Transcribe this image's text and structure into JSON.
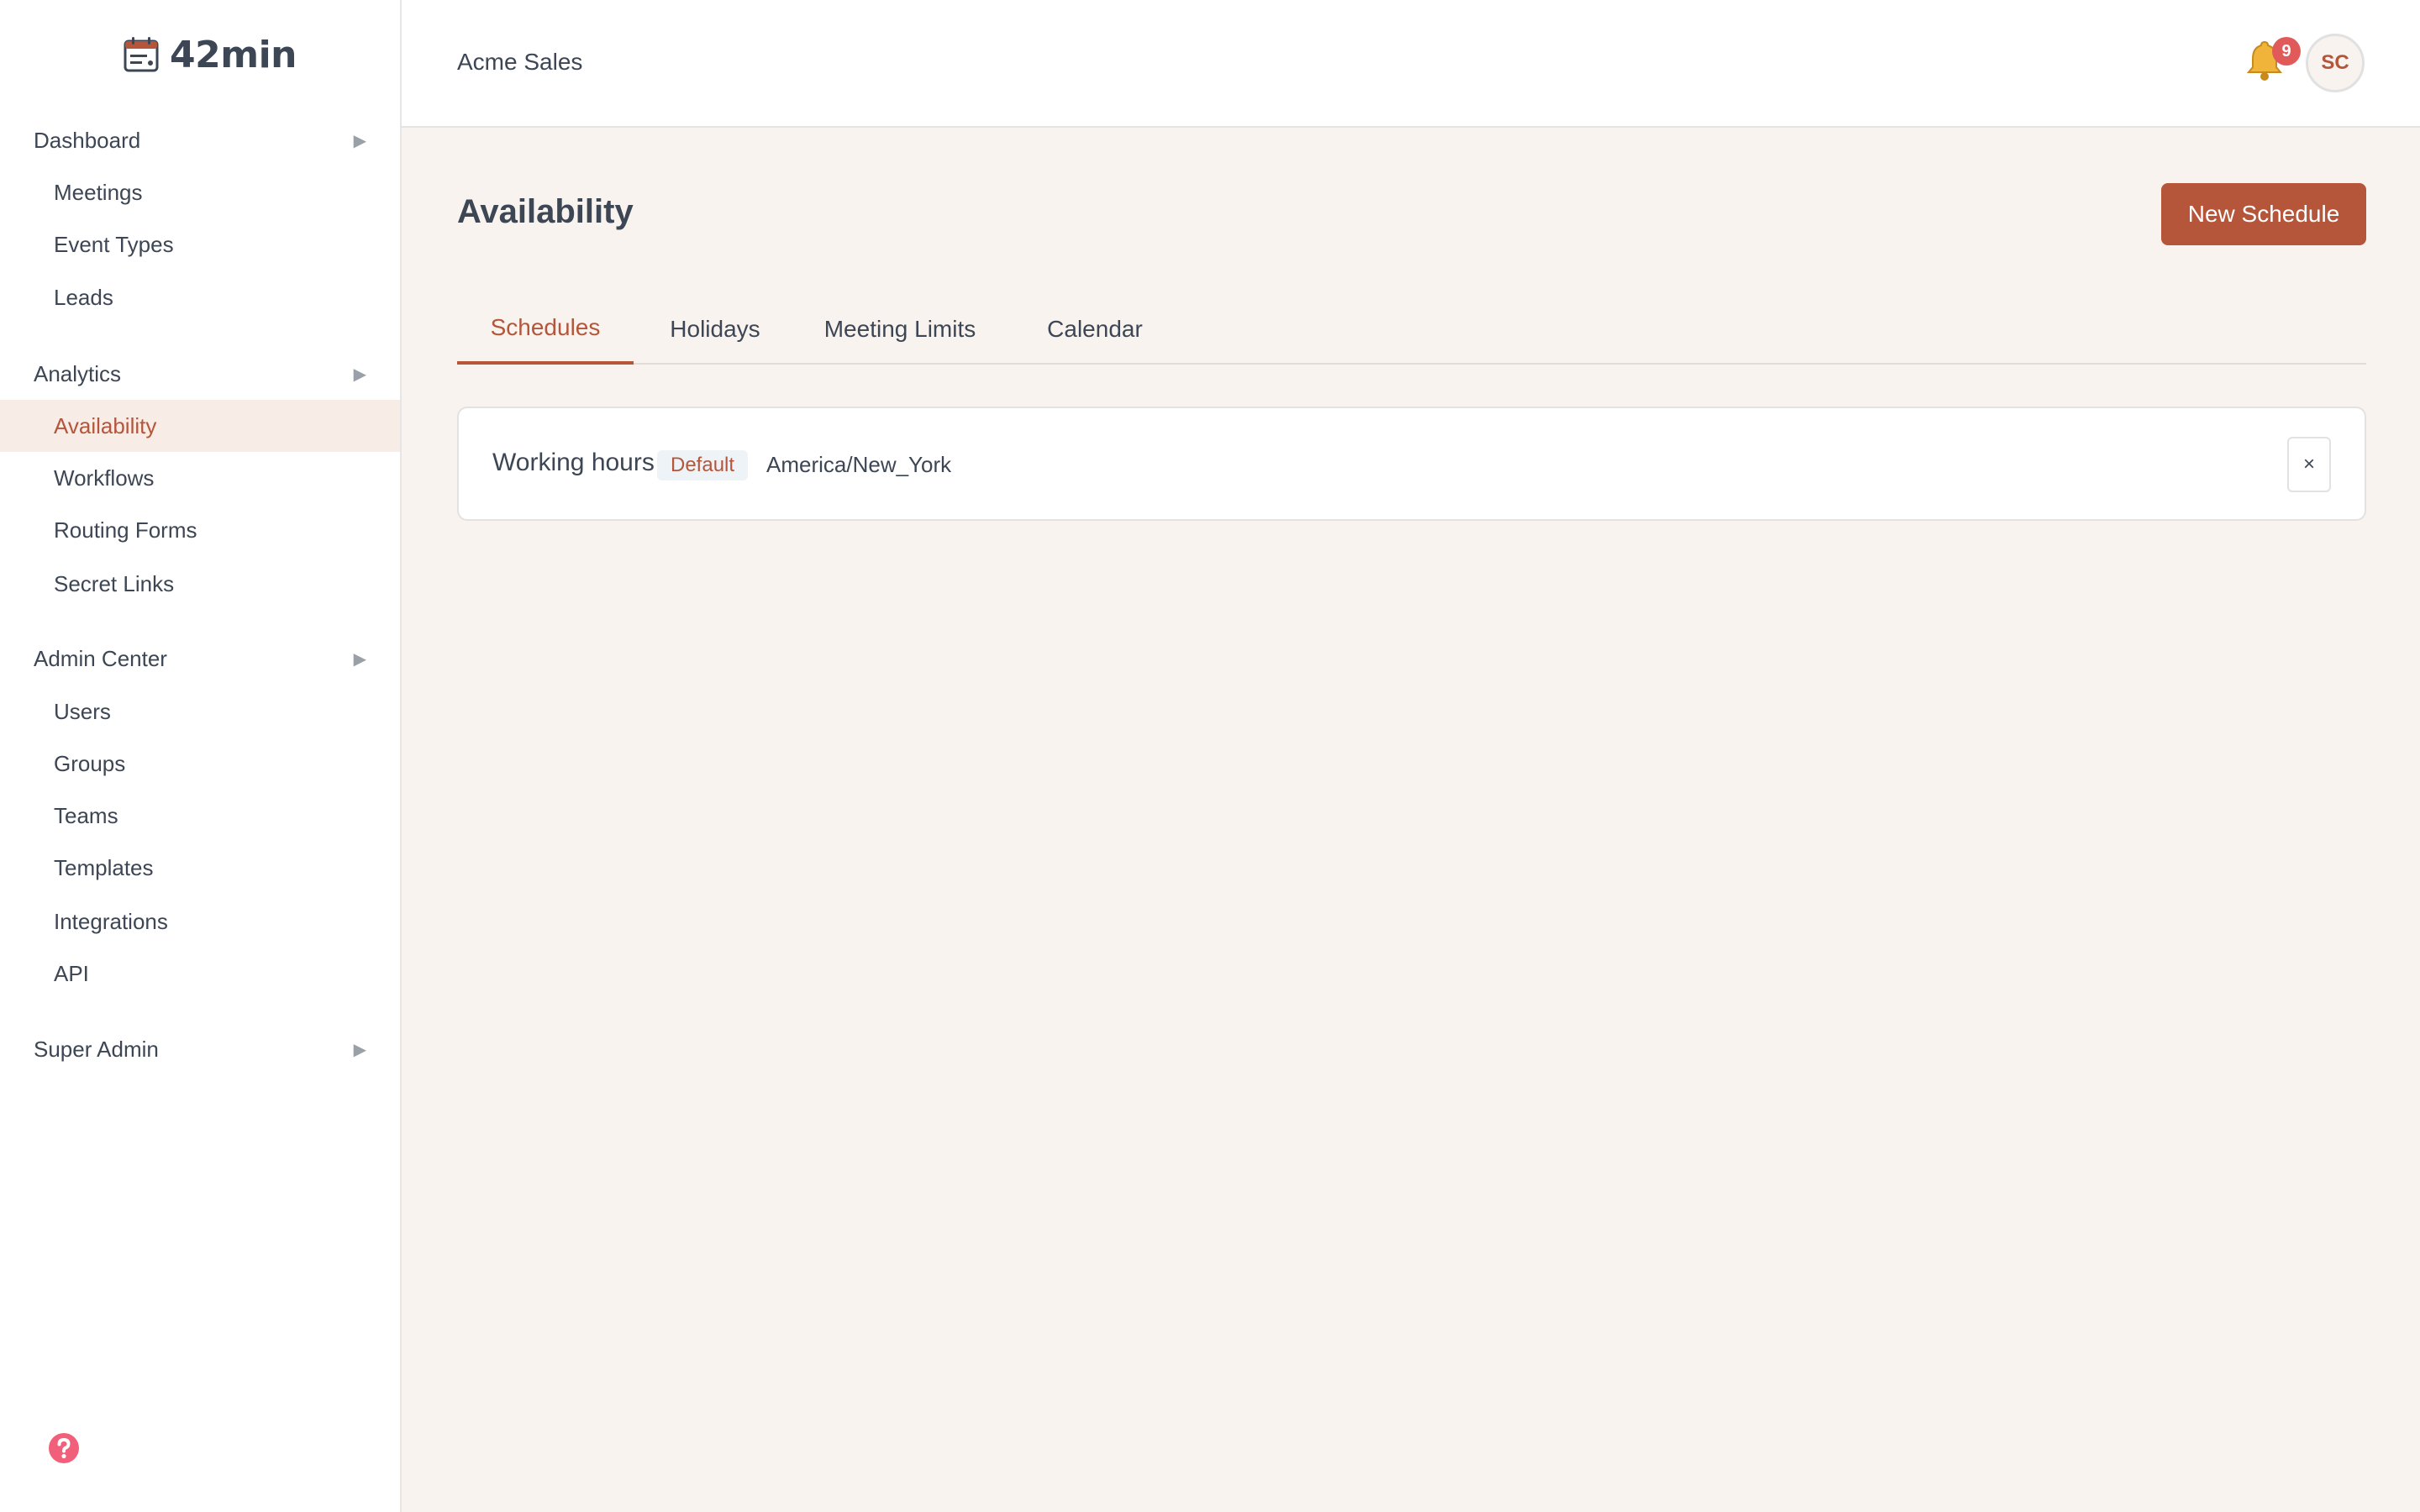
{
  "brand": {
    "name": "42min"
  },
  "sidebar": {
    "sections": [
      {
        "label": "Dashboard",
        "items": [
          {
            "label": "Meetings"
          },
          {
            "label": "Event Types"
          },
          {
            "label": "Leads"
          }
        ]
      },
      {
        "label": "Analytics",
        "items": [
          {
            "label": "Availability",
            "active": true
          },
          {
            "label": "Workflows"
          },
          {
            "label": "Routing Forms"
          },
          {
            "label": "Secret Links"
          }
        ]
      },
      {
        "label": "Admin Center",
        "items": [
          {
            "label": "Users"
          },
          {
            "label": "Groups"
          },
          {
            "label": "Teams"
          },
          {
            "label": "Templates"
          },
          {
            "label": "Integrations"
          },
          {
            "label": "API"
          }
        ]
      },
      {
        "label": "Super Admin",
        "items": []
      }
    ],
    "arrow_glyph": "▶"
  },
  "header": {
    "org": "Acme Sales",
    "notifications": {
      "count": "9",
      "icon": "bell-icon"
    },
    "avatar_initials": "SC"
  },
  "main": {
    "title": "Availability",
    "new_button": "New Schedule",
    "tabs": [
      {
        "label": "Schedules",
        "active": true
      },
      {
        "label": "Holidays"
      },
      {
        "label": "Meeting Limits"
      },
      {
        "label": "Calendar"
      }
    ],
    "schedules": [
      {
        "name": "Working hours",
        "badge": "Default",
        "timezone": "America/New_York",
        "delete": "×"
      }
    ]
  },
  "colors": {
    "accent": "#b5553a",
    "background": "#f8f3ee",
    "text": "#3d4654",
    "active_nav_bg": "#f8ece6",
    "badge": "#e05a5a",
    "help": "#f25f7a"
  }
}
